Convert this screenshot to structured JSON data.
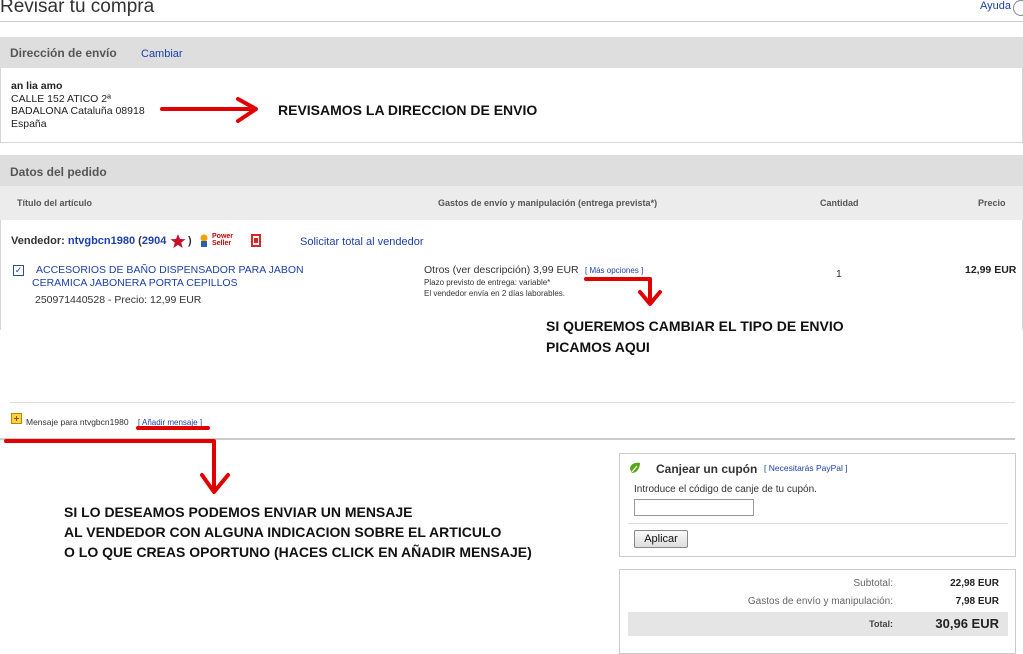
{
  "header": {
    "title": "Revisar tu compra",
    "help_label": "Ayuda"
  },
  "shipping": {
    "section_title": "Dirección de envío",
    "change_link": "Cambiar",
    "address_lines": [
      "an   lia   amo",
      "CALLE                 152 ATICO 2ª",
      "BADALONA Cataluña 08918",
      "España"
    ]
  },
  "order": {
    "section_title": "Datos del pedido",
    "columns": {
      "item": "Título del artículo",
      "shipping": "Gastos de envío y manipulación (entrega prevista*)",
      "qty": "Cantidad",
      "price": "Precio"
    },
    "seller": {
      "prefix": "Vendedor:",
      "name": "ntvgbcn1980",
      "open_paren": "(",
      "rating": "2904",
      "close_paren": ")",
      "power_seller": "Power Seller",
      "request_total": "Solicitar total al vendedor"
    },
    "item": {
      "title_line1": "ACCESORIOS DE BAÑO DISPENSADOR PARA JABON",
      "title_line2": "CERAMICA JABONERA PORTA CEPILLOS",
      "id_price": "250971440528 - Precio:  12,99 EUR",
      "shipping_text": "Otros (ver descripción) 3,99 EUR",
      "more_options": "[ Más opciones ]",
      "delivery": "Plazo previsto de entrega: variable*",
      "dispatch": "El vendedor envía en 2 días laborables.",
      "quantity": "1",
      "price": "12,99 EUR"
    },
    "message": {
      "label": "Mensaje para ntvgbcn1980",
      "add_link": "[ Añadir mensaje ]"
    }
  },
  "coupon": {
    "title": "Canjear un cupón",
    "paypal_link": "[ Necesitarás PayPal ]",
    "instruction": "Introduce el código de canje de tu cupón.",
    "input_value": "",
    "apply_label": "Aplicar"
  },
  "totals": {
    "subtotal_label": "Subtotal:",
    "subtotal_value": "22,98 EUR",
    "shipping_label": "Gastos de envío y manipulación:",
    "shipping_value": "7,98 EUR",
    "total_label": "Total:",
    "total_value": "30,96 EUR"
  },
  "annotations": {
    "address": "REVISAMOS LA DIRECCION DE ENVIO",
    "shipping_line1": "SI QUEREMOS CAMBIAR EL TIPO DE ENVIO",
    "shipping_line2": "PICAMOS AQUI",
    "message_line1": "SI LO DESEAMOS PODEMOS ENVIAR UN MENSAJE",
    "message_line2": "AL VENDEDOR CON ALGUNA INDICACION SOBRE EL ARTICULO",
    "message_line3": "O LO QUE CREAS OPORTUNO (HACES CLICK EN AÑADIR MENSAJE)"
  },
  "colors": {
    "link": "#1c3fa8",
    "annotation_arrow": "#e00000",
    "section_bar": "#dedede"
  }
}
